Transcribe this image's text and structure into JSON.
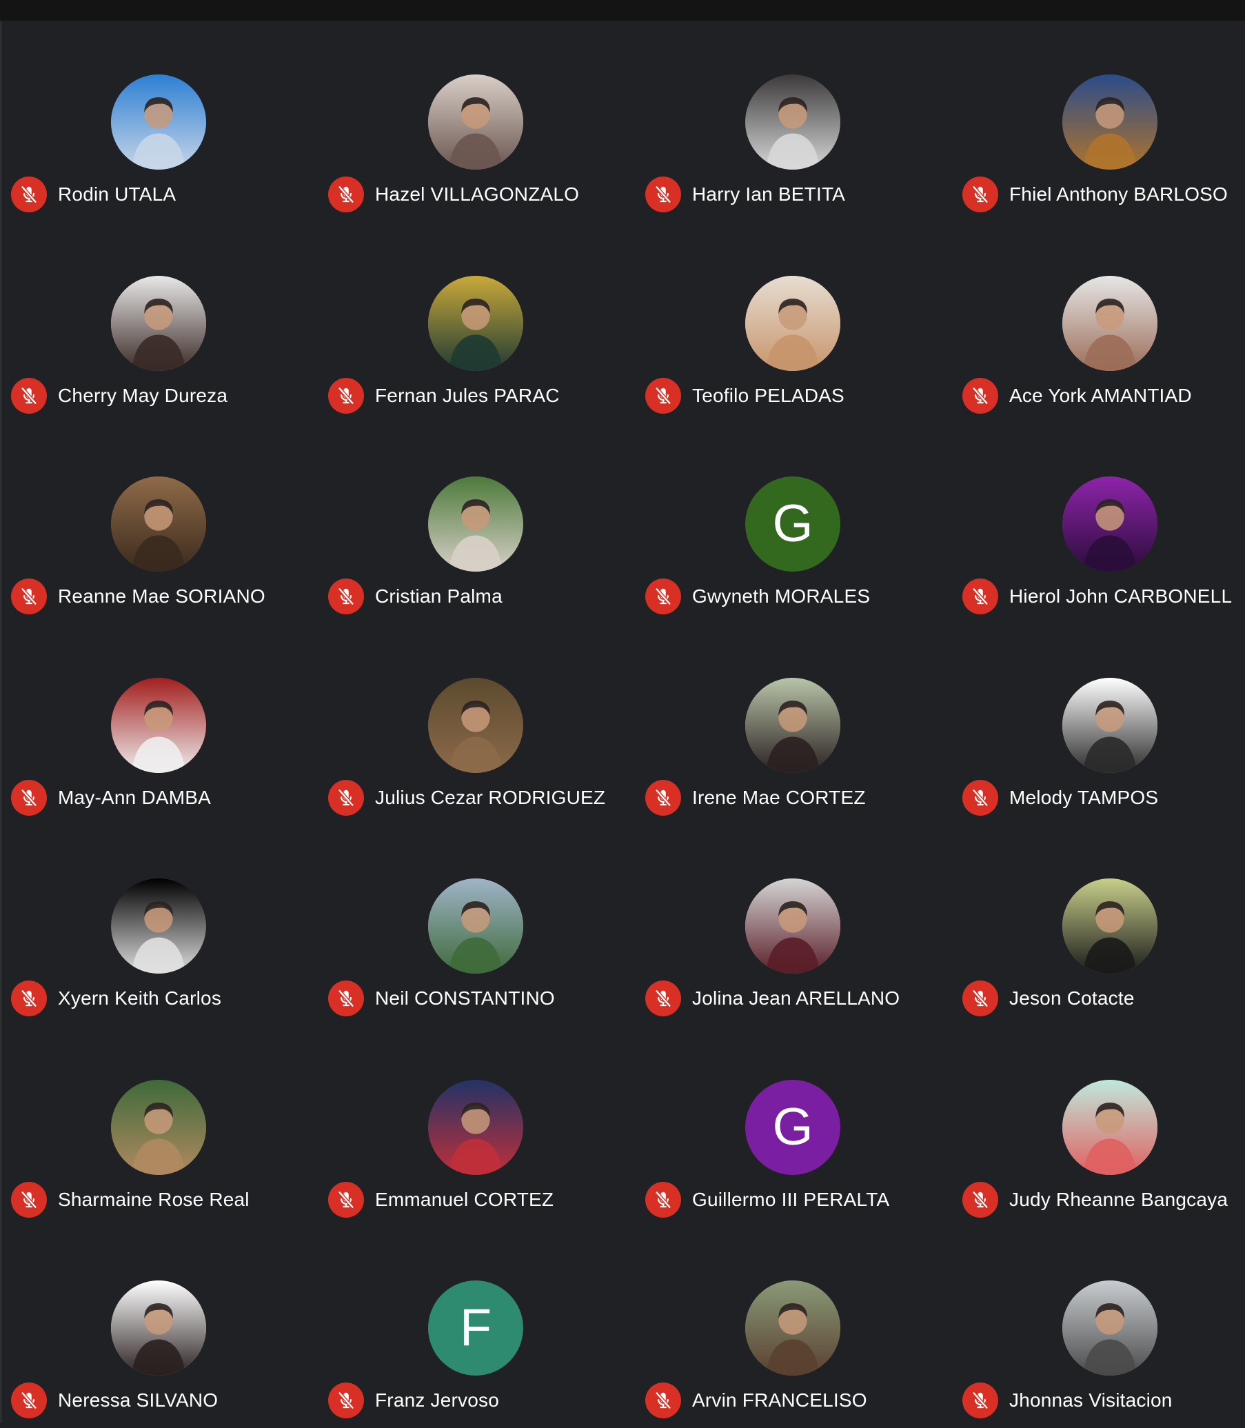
{
  "colors": {
    "background": "#202124",
    "topbar": "#141414",
    "muted_badge": "#d93025",
    "name_text": "#ffffff"
  },
  "participants": [
    {
      "name": "Rodin UTALA",
      "avatar_type": "photo",
      "avatar_colors": [
        "#2d7fd3",
        "#c8d6e8"
      ],
      "muted": true
    },
    {
      "name": "Hazel VILLAGONZALO",
      "avatar_type": "photo",
      "avatar_colors": [
        "#d9cfc8",
        "#6a5550"
      ],
      "muted": true
    },
    {
      "name": "Harry Ian BETITA",
      "avatar_type": "photo",
      "avatar_colors": [
        "#3c3a3a",
        "#d8d8d8"
      ],
      "muted": true
    },
    {
      "name": "Fhiel Anthony BARLOSO",
      "avatar_type": "photo",
      "avatar_colors": [
        "#2b4c8a",
        "#b0742c"
      ],
      "muted": true
    },
    {
      "name": "Cherry May Dureza",
      "avatar_type": "photo",
      "avatar_colors": [
        "#e8e8e8",
        "#3a2a26"
      ],
      "muted": true
    },
    {
      "name": "Fernan Jules PARAC",
      "avatar_type": "photo",
      "avatar_colors": [
        "#c9a93a",
        "#1f3a32"
      ],
      "muted": true
    },
    {
      "name": "Teofilo PELADAS",
      "avatar_type": "photo",
      "avatar_colors": [
        "#e7ddd2",
        "#c7956b"
      ],
      "muted": true
    },
    {
      "name": "Ace York AMANTIAD",
      "avatar_type": "photo",
      "avatar_colors": [
        "#e6e6e6",
        "#9c6d58"
      ],
      "muted": true
    },
    {
      "name": "Reanne Mae SORIANO",
      "avatar_type": "photo",
      "avatar_colors": [
        "#8f6b48",
        "#3a2a1e"
      ],
      "muted": true
    },
    {
      "name": "Cristian Palma",
      "avatar_type": "photo",
      "avatar_colors": [
        "#4d7a3a",
        "#d8d0c8"
      ],
      "muted": true
    },
    {
      "name": "Gwyneth MORALES",
      "avatar_type": "initial",
      "initial": "G",
      "avatar_colors": [
        "#33691e"
      ],
      "muted": true
    },
    {
      "name": "Hierol John CARBONELL",
      "avatar_type": "photo",
      "avatar_colors": [
        "#8e24aa",
        "#2a0d3a"
      ],
      "muted": true
    },
    {
      "name": "May-Ann DAMBA",
      "avatar_type": "photo",
      "avatar_colors": [
        "#a31f1f",
        "#eeeeee"
      ],
      "muted": true
    },
    {
      "name": "Julius Cezar RODRIGUEZ",
      "avatar_type": "photo",
      "avatar_colors": [
        "#5c4a2e",
        "#8c6a4a"
      ],
      "muted": true
    },
    {
      "name": "Irene Mae CORTEZ",
      "avatar_type": "photo",
      "avatar_colors": [
        "#b8c4a8",
        "#2a2020"
      ],
      "muted": true
    },
    {
      "name": "Melody TAMPOS",
      "avatar_type": "photo",
      "avatar_colors": [
        "#ffffff",
        "#2a2a2a"
      ],
      "muted": true
    },
    {
      "name": "Xyern Keith Carlos",
      "avatar_type": "photo",
      "avatar_colors": [
        "#000000",
        "#e0e0e0"
      ],
      "muted": true
    },
    {
      "name": "Neil CONSTANTINO",
      "avatar_type": "photo",
      "avatar_colors": [
        "#9fb4c8",
        "#3f6a3a"
      ],
      "muted": true
    },
    {
      "name": "Jolina Jean ARELLANO",
      "avatar_type": "photo",
      "avatar_colors": [
        "#d4d4d4",
        "#5a1e28"
      ],
      "muted": true
    },
    {
      "name": "Jeson Cotacte",
      "avatar_type": "photo",
      "avatar_colors": [
        "#c8cf8a",
        "#1a1a1a"
      ],
      "muted": true
    },
    {
      "name": "Sharmaine Rose Real",
      "avatar_type": "photo",
      "avatar_colors": [
        "#3f6a3a",
        "#b08a60"
      ],
      "muted": true
    },
    {
      "name": "Emmanuel CORTEZ",
      "avatar_type": "photo",
      "avatar_colors": [
        "#223366",
        "#c0303a"
      ],
      "muted": true
    },
    {
      "name": "Guillermo III PERALTA",
      "avatar_type": "initial",
      "initial": "G",
      "avatar_colors": [
        "#7b1fa2"
      ],
      "muted": true
    },
    {
      "name": "Judy Rheanne Bangcaya",
      "avatar_type": "photo",
      "avatar_colors": [
        "#bfe8dc",
        "#e06060"
      ],
      "muted": true
    },
    {
      "name": "Neressa SILVANO",
      "avatar_type": "photo",
      "avatar_colors": [
        "#ffffff",
        "#2a2020"
      ],
      "muted": true
    },
    {
      "name": "Franz Jervoso",
      "avatar_type": "initial",
      "initial": "F",
      "avatar_colors": [
        "#2e8b70"
      ],
      "muted": true
    },
    {
      "name": "Arvin FRANCELISO",
      "avatar_type": "photo",
      "avatar_colors": [
        "#8a9a78",
        "#5a4030"
      ],
      "muted": true
    },
    {
      "name": "Jhonnas Visitacion",
      "avatar_type": "photo",
      "avatar_colors": [
        "#c8ccd0",
        "#4a4a4a"
      ],
      "muted": true
    }
  ]
}
